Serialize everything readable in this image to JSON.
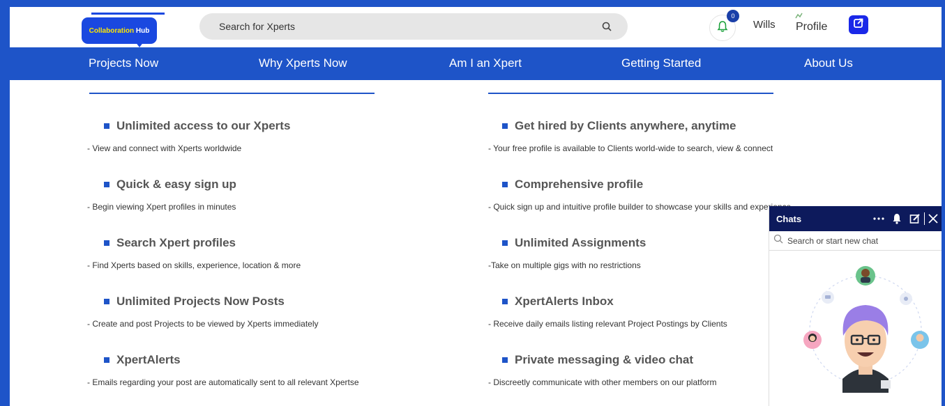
{
  "header": {
    "logo_text_a": "Collaboration",
    "logo_text_b": "Hub",
    "search_placeholder": "Search for Xperts",
    "notification_count": "0",
    "username": "Wills",
    "profile_label": "Profile",
    "icons": {
      "search": "search-icon",
      "bell": "bell-icon",
      "logout": "logout-icon"
    }
  },
  "nav": {
    "items": [
      {
        "label": "Projects Now"
      },
      {
        "label": "Why Xperts Now"
      },
      {
        "label": "Am I an Xpert"
      },
      {
        "label": "Getting Started"
      },
      {
        "label": "About Us"
      }
    ]
  },
  "clients": [
    {
      "title": "Unlimited access to our Xperts",
      "desc": "- View and connect with Xperts worldwide"
    },
    {
      "title": "Quick & easy sign up",
      "desc": "- Begin viewing Xpert profiles in minutes"
    },
    {
      "title": "Search Xpert profiles",
      "desc": "- Find Xperts based on skills, experience, location & more"
    },
    {
      "title": "Unlimited Projects Now Posts",
      "desc": "- Create and post Projects to be viewed by Xperts immediately"
    },
    {
      "title": "XpertAlerts",
      "desc": "- Emails regarding your post are automatically sent to all relevant Xpertse"
    }
  ],
  "xperts": [
    {
      "title": "Get hired by Clients anywhere, anytime",
      "desc": "- Your free profile is available to Clients world-wide to search, view & connect"
    },
    {
      "title": "Comprehensive profile",
      "desc": "- Quick sign up and intuitive profile builder to showcase your skills and experience"
    },
    {
      "title": "Unlimited Assignments",
      "desc": "-Take on multiple gigs with no restrictions"
    },
    {
      "title": "XpertAlerts Inbox",
      "desc": "- Receive daily emails listing relevant Project Postings by Clients"
    },
    {
      "title": "Private messaging & video chat",
      "desc": "- Discreetly communicate with other members on our platform"
    }
  ],
  "chat": {
    "title": "Chats",
    "search_placeholder": "Search or start new chat"
  },
  "colors": {
    "brand": "#1e54c8",
    "chat_header": "#0d1a5c",
    "logo_bg": "#1a48e0"
  }
}
